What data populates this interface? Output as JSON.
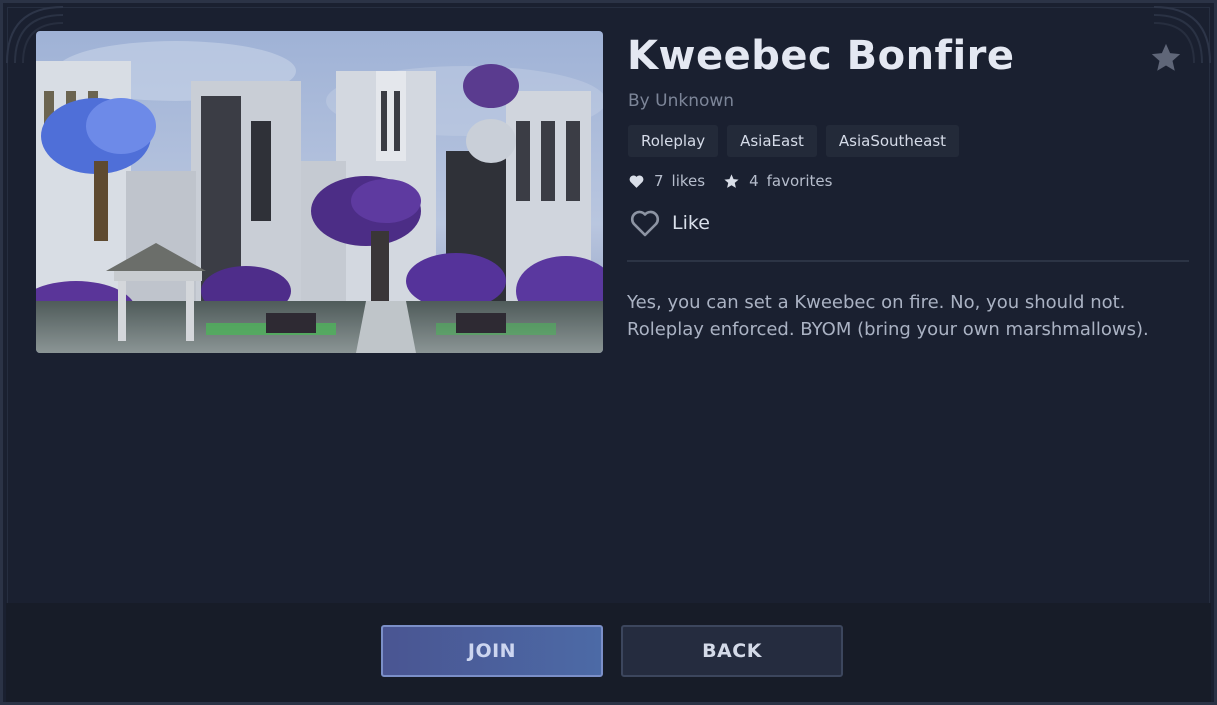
{
  "server": {
    "title": "Kweebec Bonfire",
    "author": "By Unknown",
    "tags": [
      "Roleplay",
      "AsiaEast",
      "AsiaSoutheast"
    ],
    "likes_count": "7",
    "likes_label": "likes",
    "favorites_count": "4",
    "favorites_label": "favorites",
    "like_button_label": "Like",
    "description": "Yes, you can set a Kweebec on fire. No, you should not. Roleplay enforced. BYOM (bring your own marshmallows)."
  },
  "footer": {
    "join_label": "JOIN",
    "back_label": "BACK"
  },
  "icons": {
    "favorite": "star-icon",
    "likes": "heart-icon",
    "favorites": "star-icon",
    "like": "heart-outline-icon"
  },
  "colors": {
    "background": "#1a2030",
    "accent_join": "#4c6aa6",
    "tag_background": "#232a39",
    "title": "#e4e8f2"
  }
}
